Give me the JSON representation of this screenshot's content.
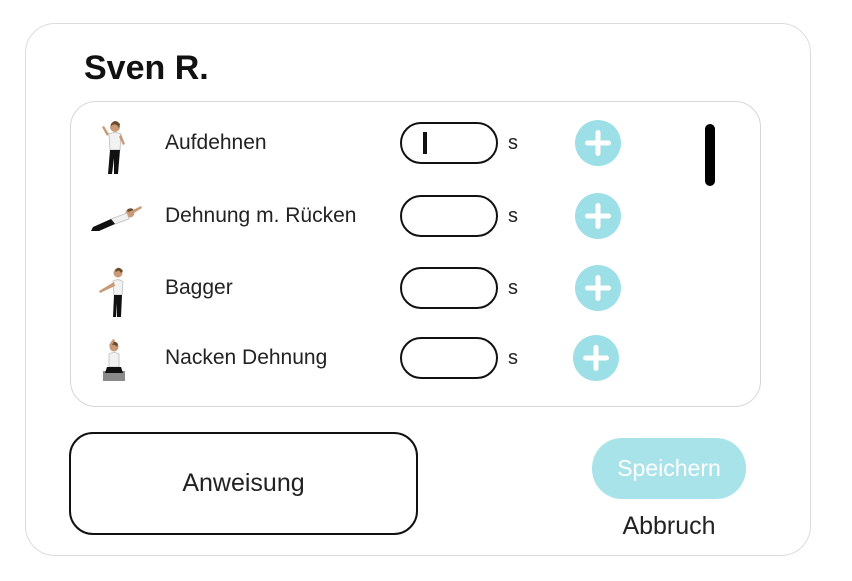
{
  "dialog": {
    "title": "Sven R."
  },
  "exercises": [
    {
      "icon": "woman-standing-stretch-figure",
      "label": "Aufdehnen",
      "seconds_value": "",
      "unit": "s",
      "add_icon": "plus-icon"
    },
    {
      "icon": "woman-lying-back-stretch-figure",
      "label": "Dehnung m. Rücken",
      "seconds_value": "",
      "unit": "s",
      "add_icon": "plus-icon"
    },
    {
      "icon": "woman-bending-arms-figure",
      "label": "Bagger",
      "seconds_value": "",
      "unit": "s",
      "add_icon": "plus-icon"
    },
    {
      "icon": "woman-seated-neck-stretch-figure",
      "label": "Nacken Dehnung",
      "seconds_value": "",
      "unit": "s",
      "add_icon": "plus-icon"
    }
  ],
  "actions": {
    "instructions_label": "Anweisung",
    "save_label": "Speichern",
    "cancel_label": "Abbruch"
  },
  "colors": {
    "accent": "#9ddfe6",
    "save_button": "#a8e3ea",
    "border": "#dcdcdc",
    "text": "#222222"
  }
}
